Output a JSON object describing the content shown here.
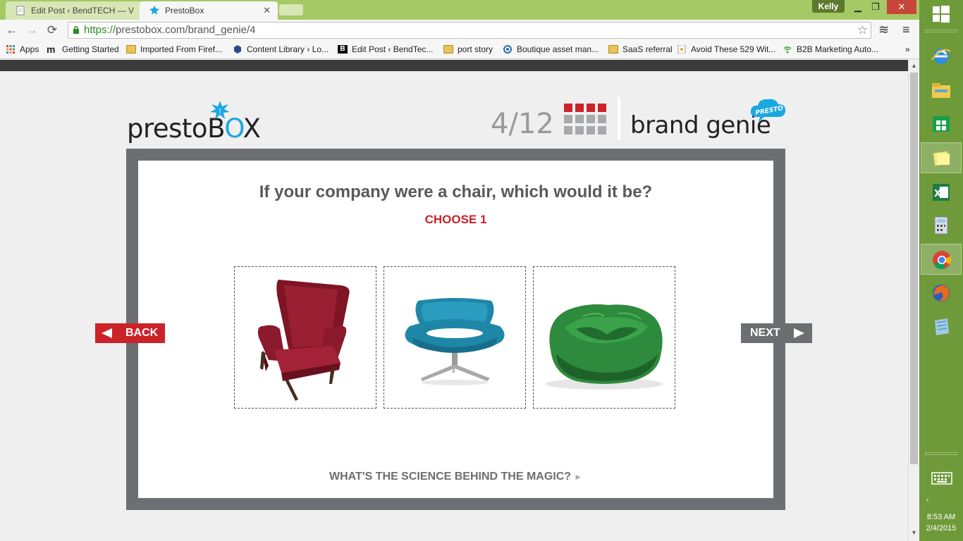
{
  "browser": {
    "tabs": [
      {
        "title": "Edit Post ‹ BendTECH — V",
        "active": false
      },
      {
        "title": "PrestoBox",
        "active": true
      }
    ],
    "user": "Kelly",
    "url_scheme": "https://",
    "url_rest": "prestobox.com/brand_genie/4",
    "bookmarks": [
      "Apps",
      "Getting Started",
      "Imported From Firef...",
      "Content Library › Lo...",
      "Edit Post ‹ BendTec...",
      "port story",
      "Boutique asset man...",
      "SaaS referral",
      "Avoid These 529 Wit...",
      "B2B Marketing Auto..."
    ],
    "bookmarks_more": "»"
  },
  "header": {
    "logo_prefix": "prestoB",
    "logo_o": "O",
    "logo_suffix": "X",
    "progress": "4/12",
    "progress_current": 4,
    "progress_total": 12,
    "brand": "brand genie",
    "brand_badge": "PRESTO"
  },
  "quiz": {
    "question": "If your company were a chair, which would it be?",
    "instruction": "CHOOSE 1",
    "options": [
      "red armchair",
      "blue swivel chair",
      "green bean bag"
    ],
    "back_label": "BACK",
    "next_label": "NEXT",
    "science_link": "WHAT'S THE SCIENCE BEHIND THE MAGIC?",
    "science_arrow": "►"
  },
  "taskbar": {
    "time": "8:53 AM",
    "date": "2/4/2015"
  },
  "colors": {
    "accent_red": "#cc2229",
    "frame_gray": "#6d6e71",
    "brand_blue": "#1aa8e0",
    "titlebar_green": "#a5c964"
  }
}
